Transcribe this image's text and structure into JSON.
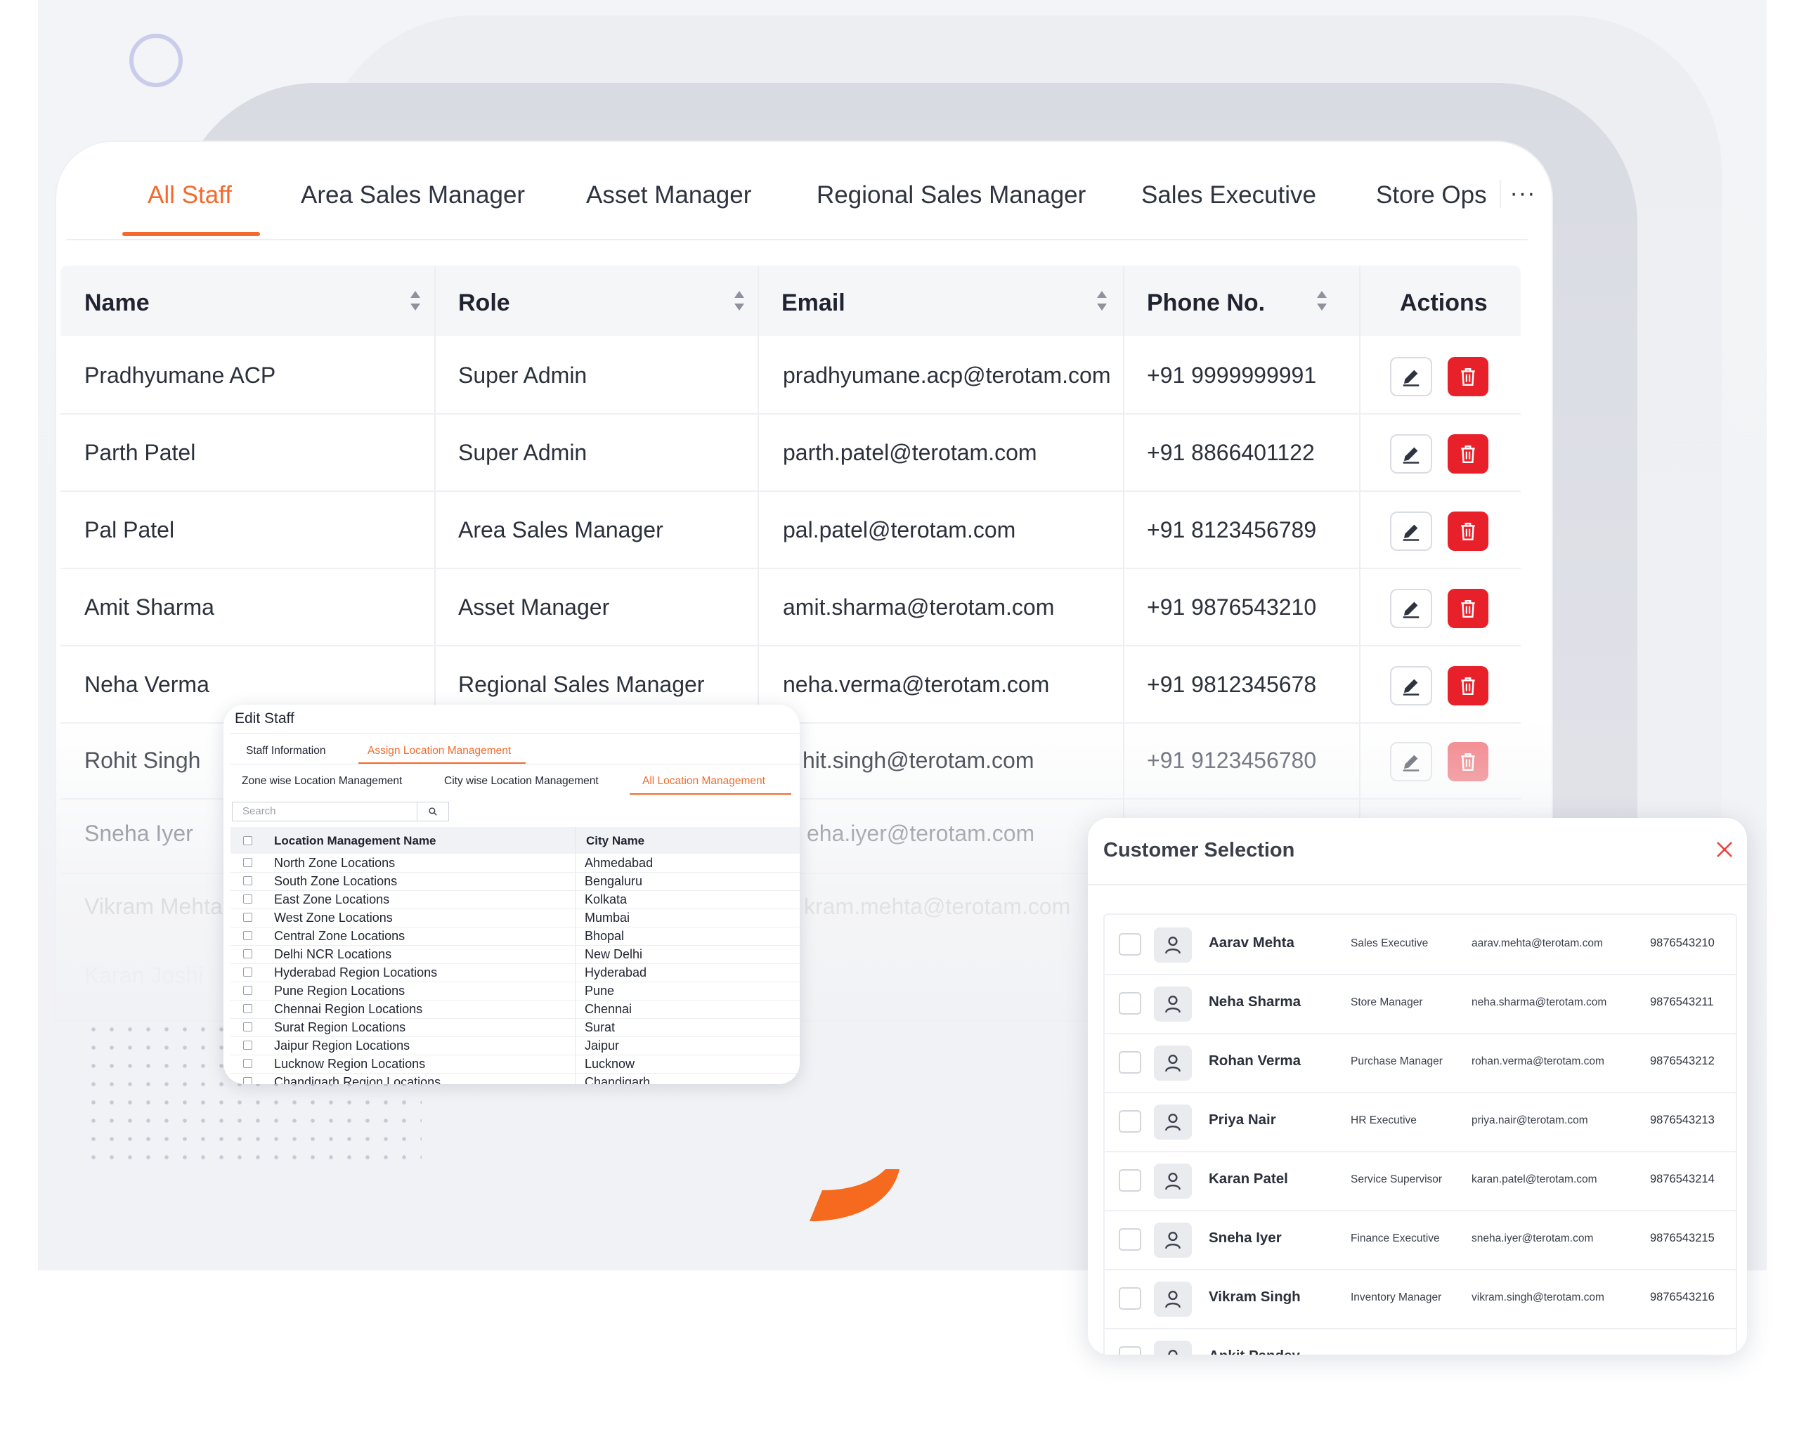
{
  "tabs": {
    "items": [
      "All Staff",
      "Area Sales Manager",
      "Asset Manager",
      "Regional Sales Manager",
      "Sales Executive",
      "Store Ops"
    ],
    "active": "All Staff",
    "more": "···"
  },
  "table": {
    "headers": {
      "name": "Name",
      "role": "Role",
      "email": "Email",
      "phone": "Phone No.",
      "actions": "Actions"
    },
    "rows": [
      {
        "name": "Pradhyumane ACP",
        "role": "Super Admin",
        "email": "pradhyumane.acp@terotam.com",
        "phone": "+91 9999999991"
      },
      {
        "name": "Parth Patel",
        "role": "Super Admin",
        "email": "parth.patel@terotam.com",
        "phone": "+91 8866401122"
      },
      {
        "name": "Pal Patel",
        "role": "Area Sales Manager",
        "email": "pal.patel@terotam.com",
        "phone": "+91 8123456789"
      },
      {
        "name": "Amit Sharma",
        "role": "Asset Manager",
        "email": "amit.sharma@terotam.com",
        "phone": "+91 9876543210"
      },
      {
        "name": "Neha Verma",
        "role": "Regional Sales Manager",
        "email": "neha.verma@terotam.com",
        "phone": "+91 9812345678"
      },
      {
        "name": "Rohit Singh",
        "role": "",
        "email": "hit.singh@terotam.com",
        "phone": "+91 9123456780"
      },
      {
        "name": "Sneha Iyer",
        "role": "",
        "email": "eha.iyer@terotam.com",
        "phone": ""
      },
      {
        "name": "Vikram Mehta",
        "role": "",
        "email": "kram.mehta@terotam.com",
        "phone": ""
      },
      {
        "name": "Karan Joshi",
        "role": "",
        "email": "",
        "phone": ""
      }
    ]
  },
  "edit_staff": {
    "title": "Edit Staff",
    "tabs": [
      "Staff Information",
      "Assign Location Management"
    ],
    "subtabs": [
      "Zone wise Location Management",
      "City wise Location Management",
      "All Location Management"
    ],
    "search_placeholder": "Search",
    "headers": {
      "location": "Location Management Name",
      "city": "City Name"
    },
    "rows": [
      {
        "location": "North Zone Locations",
        "city": "Ahmedabad"
      },
      {
        "location": "South Zone Locations",
        "city": "Bengaluru"
      },
      {
        "location": "East Zone Locations",
        "city": "Kolkata"
      },
      {
        "location": "West Zone Locations",
        "city": "Mumbai"
      },
      {
        "location": "Central Zone Locations",
        "city": "Bhopal"
      },
      {
        "location": "Delhi NCR Locations",
        "city": "New Delhi"
      },
      {
        "location": "Hyderabad Region Locations",
        "city": "Hyderabad"
      },
      {
        "location": "Pune Region Locations",
        "city": "Pune"
      },
      {
        "location": "Chennai Region Locations",
        "city": "Chennai"
      },
      {
        "location": "Surat Region Locations",
        "city": "Surat"
      },
      {
        "location": "Jaipur Region Locations",
        "city": "Jaipur"
      },
      {
        "location": "Lucknow Region Locations",
        "city": "Lucknow"
      },
      {
        "location": "Chandigarh Region Locations",
        "city": "Chandigarh"
      }
    ]
  },
  "customer_selection": {
    "title": "Customer Selection",
    "rows": [
      {
        "name": "Aarav Mehta",
        "role": "Sales Executive",
        "email": "aarav.mehta@terotam.com",
        "phone": "9876543210"
      },
      {
        "name": "Neha Sharma",
        "role": "Store Manager",
        "email": "neha.sharma@terotam.com",
        "phone": "9876543211"
      },
      {
        "name": "Rohan Verma",
        "role": "Purchase Manager",
        "email": "rohan.verma@terotam.com",
        "phone": "9876543212"
      },
      {
        "name": "Priya Nair",
        "role": "HR Executive",
        "email": "priya.nair@terotam.com",
        "phone": "9876543213"
      },
      {
        "name": "Karan Patel",
        "role": "Service Supervisor",
        "email": "karan.patel@terotam.com",
        "phone": "9876543214"
      },
      {
        "name": "Sneha Iyer",
        "role": "Finance Executive",
        "email": "sneha.iyer@terotam.com",
        "phone": "9876543215"
      },
      {
        "name": "Vikram Singh",
        "role": "Inventory Manager",
        "email": "vikram.singh@terotam.com",
        "phone": "9876543216"
      },
      {
        "name": "Ankit Pandey",
        "role": "",
        "email": "",
        "phone": ""
      }
    ]
  },
  "icons": {
    "edit": "pencil-icon",
    "delete": "trash-icon",
    "sort": "sort-arrows-icon",
    "search": "search-icon",
    "close": "close-icon",
    "user": "user-icon"
  },
  "colors": {
    "accent": "#f26b2c",
    "danger": "#e8202a",
    "text": "#1f2430"
  }
}
